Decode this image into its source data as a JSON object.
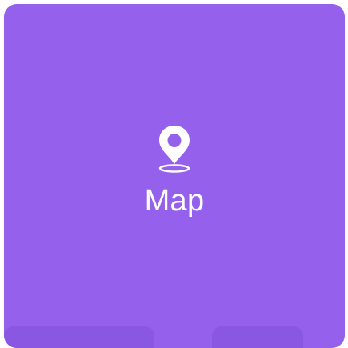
{
  "tile": {
    "label": "Map",
    "icon": "map-pin-icon",
    "color": "#9561ec",
    "icon_color": "#ffffff",
    "strip_color": "#8a57e2"
  }
}
